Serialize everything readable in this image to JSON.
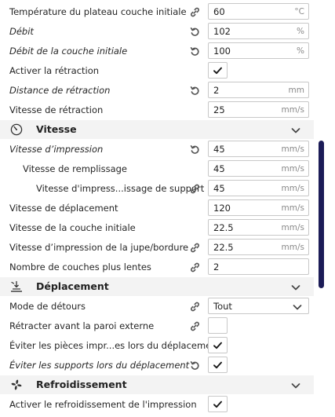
{
  "rows_top": [
    {
      "label": "Température du plateau couche initiale",
      "italic": false,
      "icon": "link-icon",
      "value": "60",
      "unit": "°C"
    },
    {
      "label": "Débit",
      "italic": true,
      "icon": "reset-icon",
      "value": "102",
      "unit": "%"
    },
    {
      "label": "Débit de la couche initiale",
      "italic": true,
      "icon": "reset-icon",
      "value": "100",
      "unit": "%"
    },
    {
      "label": "Activer la rétraction",
      "italic": false,
      "icon": "",
      "checked": true
    },
    {
      "label": "Distance de rétraction",
      "italic": true,
      "icon": "reset-icon",
      "value": "2",
      "unit": "mm"
    },
    {
      "label": "Vitesse de rétraction",
      "italic": false,
      "icon": "",
      "value": "25",
      "unit": "mm/s"
    }
  ],
  "sections": {
    "speed": {
      "title": "Vitesse",
      "icon": "speedometer-icon"
    },
    "travel": {
      "title": "Déplacement",
      "icon": "travel-icon"
    },
    "cooling": {
      "title": "Refroidissement",
      "icon": "fan-icon"
    }
  },
  "rows_speed": [
    {
      "label": "Vitesse d’impression",
      "italic": true,
      "icon": "reset-icon",
      "value": "45",
      "unit": "mm/s",
      "indent": 0
    },
    {
      "label": "Vitesse de remplissage",
      "italic": false,
      "icon": "",
      "value": "45",
      "unit": "mm/s",
      "indent": 1
    },
    {
      "label": "Vitesse d'impress...issage de support",
      "italic": false,
      "icon": "link-icon",
      "value": "45",
      "unit": "mm/s",
      "indent": 2
    },
    {
      "label": "Vitesse de déplacement",
      "italic": false,
      "icon": "",
      "value": "120",
      "unit": "mm/s",
      "indent": 0
    },
    {
      "label": "Vitesse de la couche initiale",
      "italic": false,
      "icon": "",
      "value": "22.5",
      "unit": "mm/s",
      "indent": 0
    },
    {
      "label": "Vitesse d’impression de la jupe/bordure",
      "italic": false,
      "icon": "link-icon",
      "value": "22.5",
      "unit": "mm/s",
      "indent": 0
    },
    {
      "label": "Nombre de couches plus lentes",
      "italic": false,
      "icon": "link-icon",
      "value": "2",
      "unit": "",
      "indent": 0
    }
  ],
  "rows_travel": [
    {
      "label": "Mode de détours",
      "italic": false,
      "icon": "link-icon",
      "select": "Tout"
    },
    {
      "label": "Rétracter avant la paroi externe",
      "italic": false,
      "icon": "link-icon",
      "checked": false
    },
    {
      "label": "Éviter les pièces impr...es lors du déplacement",
      "italic": false,
      "icon": "",
      "checked": true
    },
    {
      "label": "Éviter les supports lors du déplacement",
      "italic": true,
      "icon": "reset-icon",
      "checked": true
    }
  ],
  "rows_cooling": [
    {
      "label": "Activer le refroidissement de l'impression",
      "italic": false,
      "icon": "",
      "checked": true
    }
  ]
}
